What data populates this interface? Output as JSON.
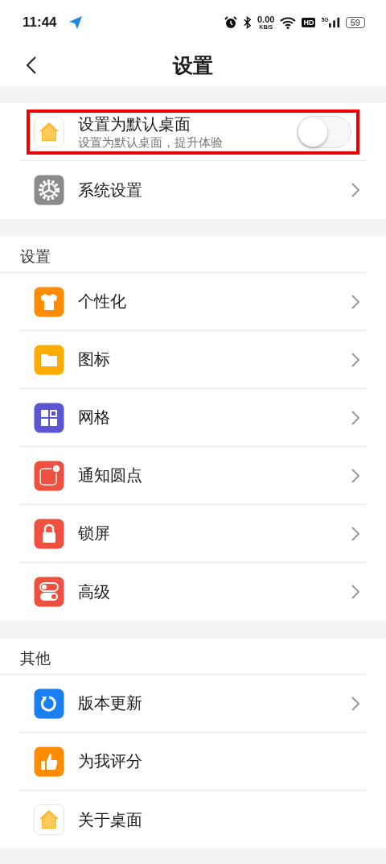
{
  "status_bar": {
    "time": "11:44",
    "speed_value": "0.00",
    "speed_unit": "KB/S",
    "hd": "HD",
    "network": "5G",
    "battery": "59"
  },
  "header": {
    "title": "设置"
  },
  "sections": [
    {
      "items": [
        {
          "kind": "toggle",
          "title": "设置为默认桌面",
          "subtitle": "设置为默认桌面，提升体验",
          "on": false,
          "highlighted": true
        },
        {
          "kind": "link",
          "title": "系统设置",
          "chevron": true
        }
      ]
    },
    {
      "title": "设置",
      "items": [
        {
          "kind": "link",
          "title": "个性化",
          "chevron": true
        },
        {
          "kind": "link",
          "title": "图标",
          "chevron": true
        },
        {
          "kind": "link",
          "title": "网格",
          "chevron": true
        },
        {
          "kind": "link",
          "title": "通知圆点",
          "chevron": true
        },
        {
          "kind": "link",
          "title": "锁屏",
          "chevron": true
        },
        {
          "kind": "link",
          "title": "高级",
          "chevron": true
        }
      ]
    },
    {
      "title": "其他",
      "items": [
        {
          "kind": "link",
          "title": "版本更新",
          "chevron": true
        },
        {
          "kind": "link",
          "title": "为我评分",
          "chevron": false
        },
        {
          "kind": "link",
          "title": "关于桌面",
          "chevron": false
        }
      ]
    }
  ]
}
